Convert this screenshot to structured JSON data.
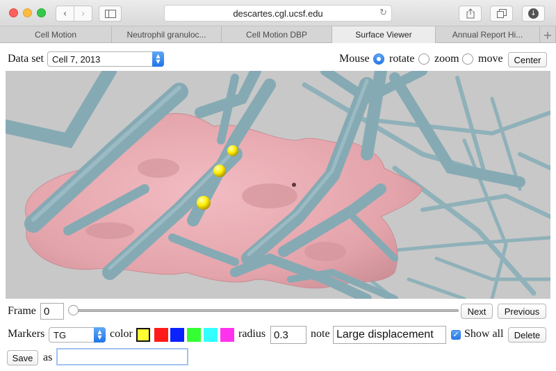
{
  "browser": {
    "url": "descartes.cgl.ucsf.edu",
    "tabs": [
      {
        "label": "Cell Motion",
        "active": false
      },
      {
        "label": "Neutrophil granuloc...",
        "active": false
      },
      {
        "label": "Cell Motion DBP",
        "active": false
      },
      {
        "label": "Surface Viewer",
        "active": true
      },
      {
        "label": "Annual Report Hi...",
        "active": false
      }
    ],
    "new_tab": "+"
  },
  "controls": {
    "dataset_label": "Data set",
    "dataset_value": "Cell 7, 2013",
    "mouse_label": "Mouse",
    "mouse_modes": [
      {
        "label": "rotate",
        "selected": true
      },
      {
        "label": "zoom",
        "selected": false
      },
      {
        "label": "move",
        "selected": false
      }
    ],
    "center_label": "Center"
  },
  "viewer": {
    "background": "#c8c8c8",
    "cell_color": "#e8aab0",
    "fiber_color": "#8fb2bb",
    "marker_color": "#ffff00"
  },
  "frame": {
    "label": "Frame",
    "value": "0",
    "next_label": "Next",
    "previous_label": "Previous"
  },
  "markers": {
    "label": "Markers",
    "set_value": "TG",
    "color_label": "color",
    "colors": [
      "#ffff33",
      "#ff1a1a",
      "#0a22ff",
      "#33ff33",
      "#33ffff",
      "#ff33ee"
    ],
    "selected_color_index": 0,
    "radius_label": "radius",
    "radius_value": "0.3",
    "note_label": "note",
    "note_value": "Large displacement",
    "show_all_label": "Show all",
    "show_all_checked": true,
    "delete_label": "Delete"
  },
  "save": {
    "save_label": "Save",
    "as_label": "as",
    "name_value": ""
  }
}
